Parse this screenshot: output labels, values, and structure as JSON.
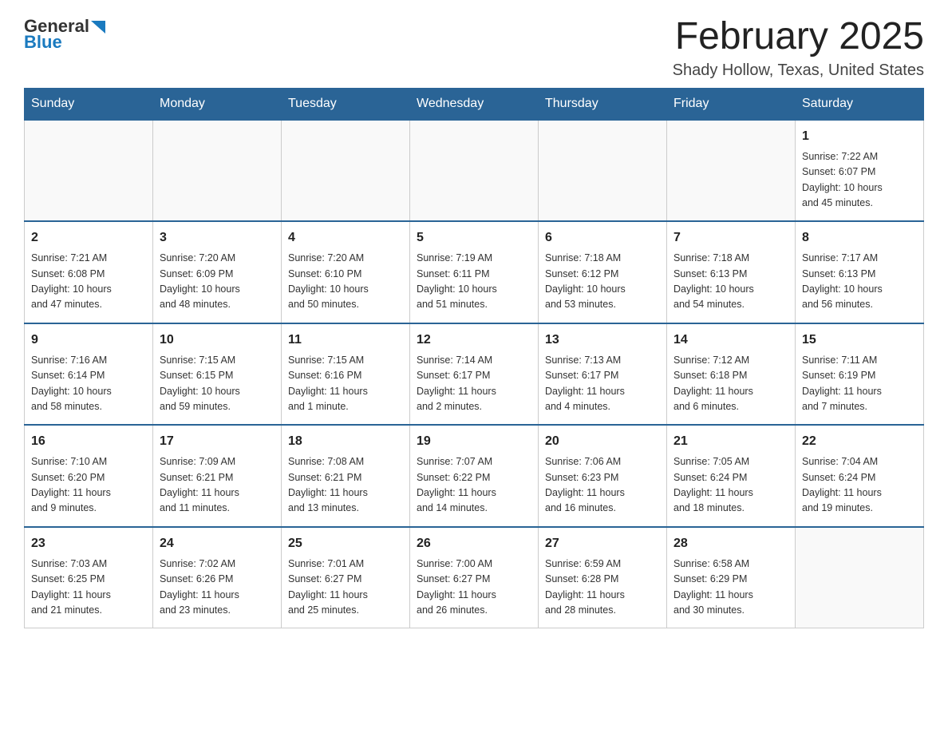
{
  "header": {
    "logo": {
      "general": "General",
      "blue": "Blue"
    },
    "title": "February 2025",
    "location": "Shady Hollow, Texas, United States"
  },
  "weekdays": [
    "Sunday",
    "Monday",
    "Tuesday",
    "Wednesday",
    "Thursday",
    "Friday",
    "Saturday"
  ],
  "weeks": [
    [
      {
        "day": "",
        "info": ""
      },
      {
        "day": "",
        "info": ""
      },
      {
        "day": "",
        "info": ""
      },
      {
        "day": "",
        "info": ""
      },
      {
        "day": "",
        "info": ""
      },
      {
        "day": "",
        "info": ""
      },
      {
        "day": "1",
        "info": "Sunrise: 7:22 AM\nSunset: 6:07 PM\nDaylight: 10 hours\nand 45 minutes."
      }
    ],
    [
      {
        "day": "2",
        "info": "Sunrise: 7:21 AM\nSunset: 6:08 PM\nDaylight: 10 hours\nand 47 minutes."
      },
      {
        "day": "3",
        "info": "Sunrise: 7:20 AM\nSunset: 6:09 PM\nDaylight: 10 hours\nand 48 minutes."
      },
      {
        "day": "4",
        "info": "Sunrise: 7:20 AM\nSunset: 6:10 PM\nDaylight: 10 hours\nand 50 minutes."
      },
      {
        "day": "5",
        "info": "Sunrise: 7:19 AM\nSunset: 6:11 PM\nDaylight: 10 hours\nand 51 minutes."
      },
      {
        "day": "6",
        "info": "Sunrise: 7:18 AM\nSunset: 6:12 PM\nDaylight: 10 hours\nand 53 minutes."
      },
      {
        "day": "7",
        "info": "Sunrise: 7:18 AM\nSunset: 6:13 PM\nDaylight: 10 hours\nand 54 minutes."
      },
      {
        "day": "8",
        "info": "Sunrise: 7:17 AM\nSunset: 6:13 PM\nDaylight: 10 hours\nand 56 minutes."
      }
    ],
    [
      {
        "day": "9",
        "info": "Sunrise: 7:16 AM\nSunset: 6:14 PM\nDaylight: 10 hours\nand 58 minutes."
      },
      {
        "day": "10",
        "info": "Sunrise: 7:15 AM\nSunset: 6:15 PM\nDaylight: 10 hours\nand 59 minutes."
      },
      {
        "day": "11",
        "info": "Sunrise: 7:15 AM\nSunset: 6:16 PM\nDaylight: 11 hours\nand 1 minute."
      },
      {
        "day": "12",
        "info": "Sunrise: 7:14 AM\nSunset: 6:17 PM\nDaylight: 11 hours\nand 2 minutes."
      },
      {
        "day": "13",
        "info": "Sunrise: 7:13 AM\nSunset: 6:17 PM\nDaylight: 11 hours\nand 4 minutes."
      },
      {
        "day": "14",
        "info": "Sunrise: 7:12 AM\nSunset: 6:18 PM\nDaylight: 11 hours\nand 6 minutes."
      },
      {
        "day": "15",
        "info": "Sunrise: 7:11 AM\nSunset: 6:19 PM\nDaylight: 11 hours\nand 7 minutes."
      }
    ],
    [
      {
        "day": "16",
        "info": "Sunrise: 7:10 AM\nSunset: 6:20 PM\nDaylight: 11 hours\nand 9 minutes."
      },
      {
        "day": "17",
        "info": "Sunrise: 7:09 AM\nSunset: 6:21 PM\nDaylight: 11 hours\nand 11 minutes."
      },
      {
        "day": "18",
        "info": "Sunrise: 7:08 AM\nSunset: 6:21 PM\nDaylight: 11 hours\nand 13 minutes."
      },
      {
        "day": "19",
        "info": "Sunrise: 7:07 AM\nSunset: 6:22 PM\nDaylight: 11 hours\nand 14 minutes."
      },
      {
        "day": "20",
        "info": "Sunrise: 7:06 AM\nSunset: 6:23 PM\nDaylight: 11 hours\nand 16 minutes."
      },
      {
        "day": "21",
        "info": "Sunrise: 7:05 AM\nSunset: 6:24 PM\nDaylight: 11 hours\nand 18 minutes."
      },
      {
        "day": "22",
        "info": "Sunrise: 7:04 AM\nSunset: 6:24 PM\nDaylight: 11 hours\nand 19 minutes."
      }
    ],
    [
      {
        "day": "23",
        "info": "Sunrise: 7:03 AM\nSunset: 6:25 PM\nDaylight: 11 hours\nand 21 minutes."
      },
      {
        "day": "24",
        "info": "Sunrise: 7:02 AM\nSunset: 6:26 PM\nDaylight: 11 hours\nand 23 minutes."
      },
      {
        "day": "25",
        "info": "Sunrise: 7:01 AM\nSunset: 6:27 PM\nDaylight: 11 hours\nand 25 minutes."
      },
      {
        "day": "26",
        "info": "Sunrise: 7:00 AM\nSunset: 6:27 PM\nDaylight: 11 hours\nand 26 minutes."
      },
      {
        "day": "27",
        "info": "Sunrise: 6:59 AM\nSunset: 6:28 PM\nDaylight: 11 hours\nand 28 minutes."
      },
      {
        "day": "28",
        "info": "Sunrise: 6:58 AM\nSunset: 6:29 PM\nDaylight: 11 hours\nand 30 minutes."
      },
      {
        "day": "",
        "info": ""
      }
    ]
  ]
}
